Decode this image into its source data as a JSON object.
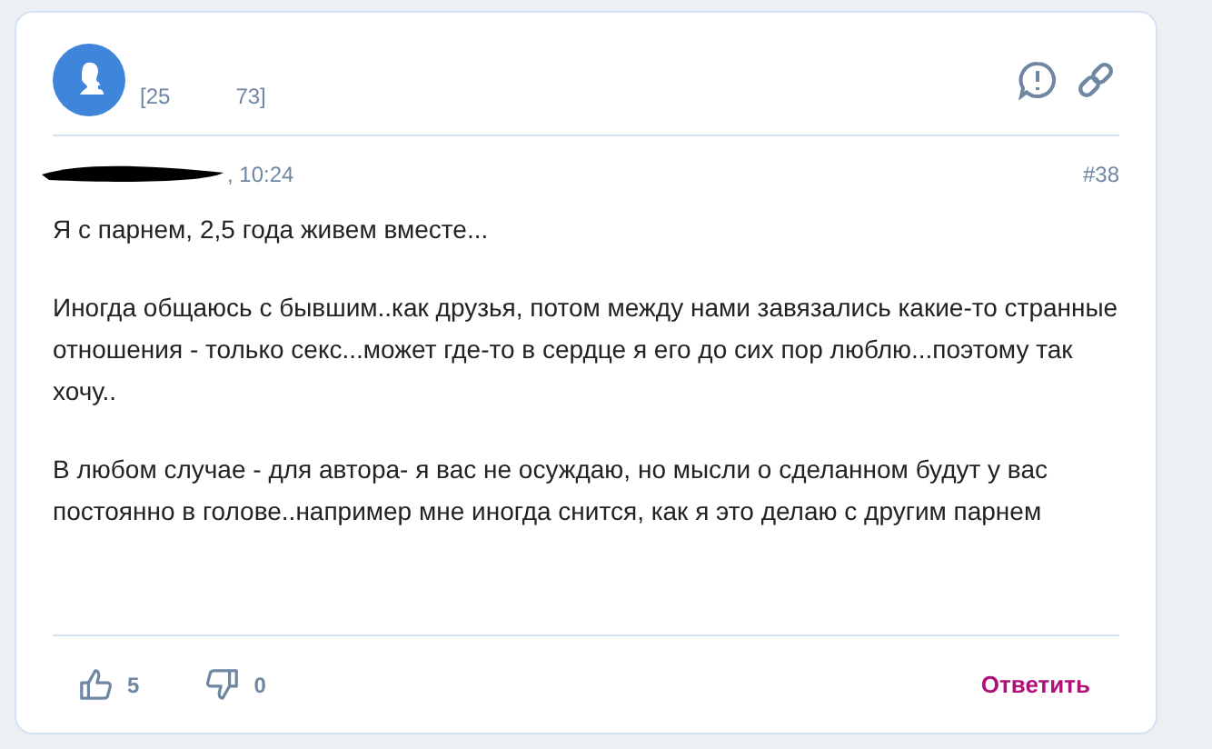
{
  "post": {
    "author_id_start": "[25",
    "author_id_end": "73]",
    "time": ", 10:24",
    "number": "#38",
    "paragraphs": [
      "Я с парнем, 2,5 года живем вместе...",
      "Иногда общаюсь с бывшим..как друзья, потом между нами завязались какие-то странные отношения - только секс...может где-то в сердце я его до сих пор люблю...поэтому так хочу..",
      "В любом случае - для автора- я вас не осуждаю, но мысли о сделанном будут у вас постоянно в голове..например мне иногда снится, как я это делаю с другим парнем"
    ],
    "likes": "5",
    "dislikes": "0",
    "reply": "Ответить"
  }
}
